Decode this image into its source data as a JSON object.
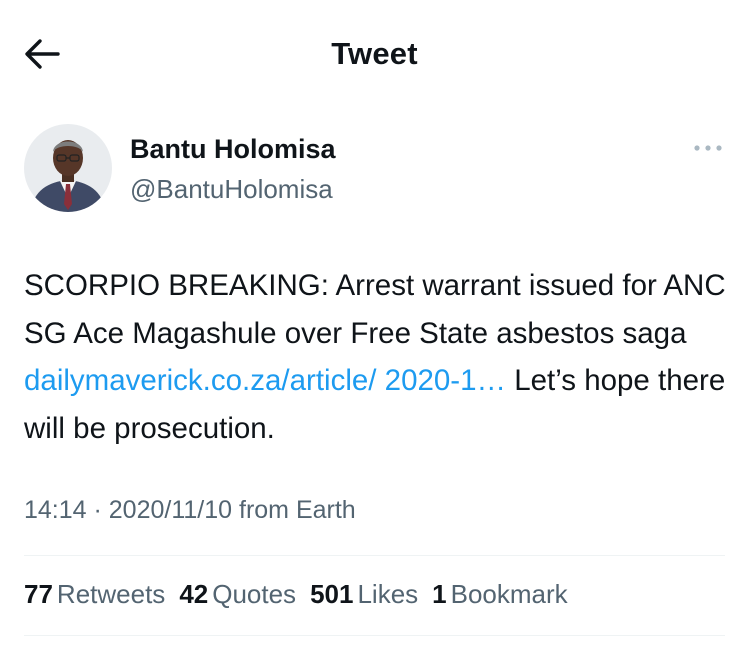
{
  "header": {
    "title": "Tweet",
    "back_icon": "arrow-left-icon"
  },
  "author": {
    "display_name": "Bantu Holomisa",
    "handle": "@BantuHolomisa",
    "avatar_icon": "avatar-portrait"
  },
  "more_icon": "more-horizontal-icon",
  "tweet": {
    "text_part1": "SCORPIO BREAKING: Arrest warrant issued for ANC SG Ace Magashule over Free State asbestos saga ",
    "link_text": "dailymaverick.co.za/article/ 2020-1…",
    "text_part2": " Let’s hope there will be prosecution."
  },
  "meta": {
    "time": "14:14",
    "separator": " · ",
    "date": "2020/11/10",
    "source": " from Earth"
  },
  "stats": {
    "retweets_count": "77",
    "retweets_label": "Retweets",
    "quotes_count": "42",
    "quotes_label": "Quotes",
    "likes_count": "501",
    "likes_label": "Likes",
    "bookmarks_count": "1",
    "bookmarks_label": "Bookmark"
  },
  "colors": {
    "link": "#1d9bf0",
    "text": "#0f1419",
    "secondary": "#536471",
    "divider": "#eff3f4"
  }
}
